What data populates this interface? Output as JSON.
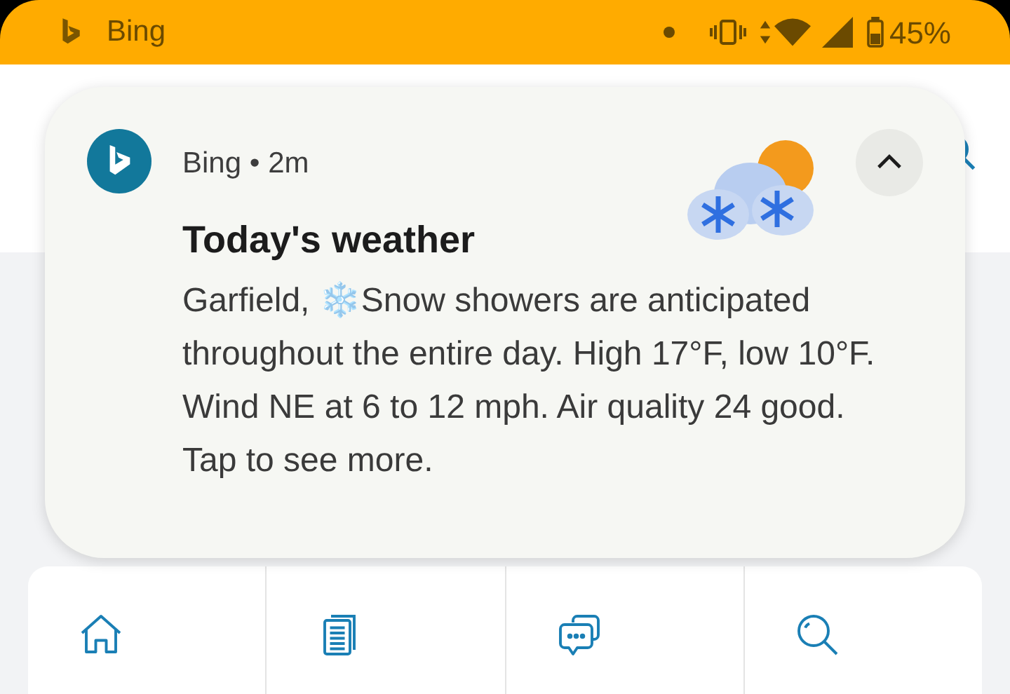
{
  "status_bar": {
    "app": "Bing",
    "battery": "45%"
  },
  "notification": {
    "app": "Bing",
    "separator": "•",
    "time": "2m",
    "expanded": true,
    "title": "Today's weather",
    "body": "Garfield, ❄️Snow showers are anticipated throughout the entire day. High 17°F, low 10°F. Wind NE at 6 to 12 mph. Air quality 24 good. Tap to see more."
  }
}
